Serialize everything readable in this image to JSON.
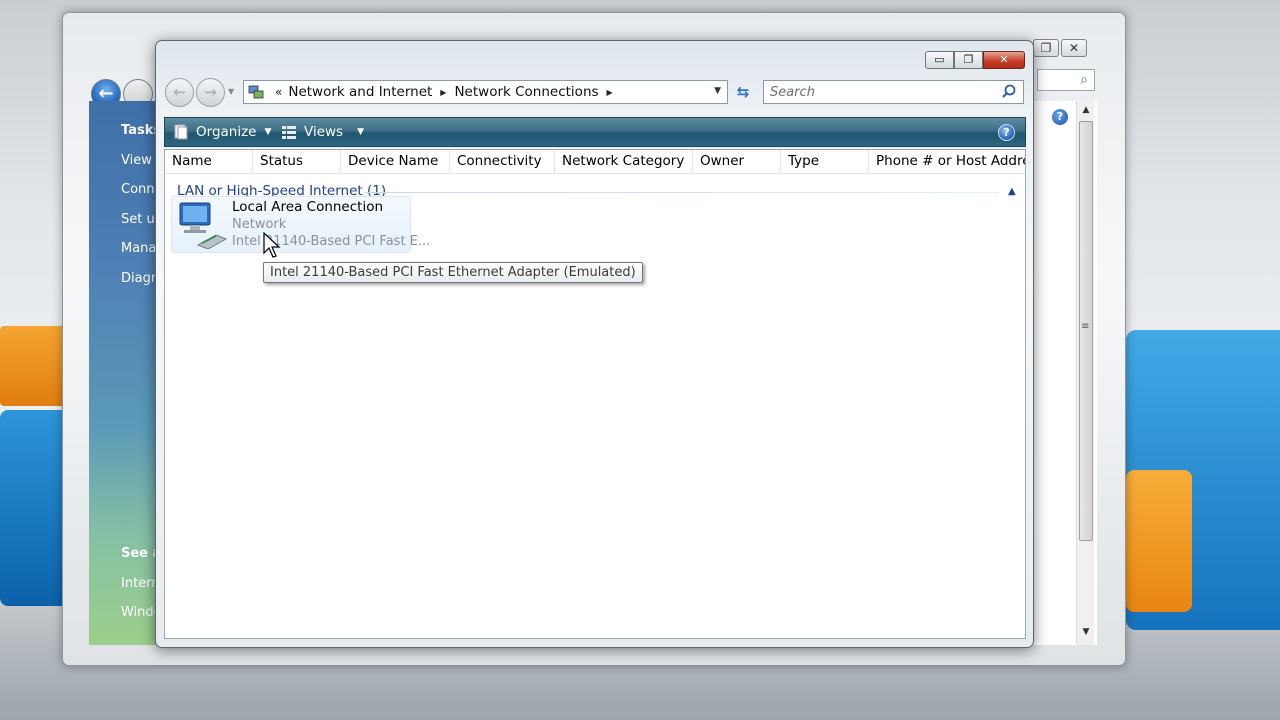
{
  "front_window": {
    "title_buttons": {
      "minimize": "▭",
      "maximize": "❐",
      "close": "✕"
    },
    "address": {
      "prefix": "«",
      "crumbs": [
        "Network and Internet",
        "Network Connections"
      ]
    },
    "search": {
      "placeholder": "Search"
    },
    "toolbar": {
      "organize_label": "Organize",
      "views_label": "Views",
      "help_label": "?"
    },
    "columns": [
      "Name",
      "Status",
      "Device Name",
      "Connectivity",
      "Network Category",
      "Owner",
      "Type",
      "Phone # or Host Addre..."
    ],
    "group": {
      "label": "LAN or High-Speed Internet (1)"
    },
    "items": [
      {
        "name": "Local Area Connection",
        "status": "Network",
        "device": "Intel 21140-Based PCI Fast E..."
      }
    ],
    "tooltip": "Intel 21140-Based PCI Fast Ethernet Adapter (Emulated)"
  },
  "back_window": {
    "sidebar": {
      "tasks_title": "Tasks",
      "items": [
        "View c",
        "Conn",
        "Set up",
        "Mana",
        "Diagn"
      ],
      "see_also": "See al",
      "see_also_items": [
        "Intern",
        "Windo"
      ]
    },
    "help_label": "?"
  },
  "colors": {
    "toolbar": "#2e6780",
    "group_header": "#1e3f8f",
    "close_button": "#c9402a",
    "desktop_orange": "#f4a531",
    "desktop_blue": "#2e95d8"
  },
  "icons": [
    "network-icon",
    "search-icon",
    "refresh-icon",
    "organize-icon",
    "views-icon",
    "help-icon",
    "network-adapter-icon",
    "cursor-icon"
  ]
}
